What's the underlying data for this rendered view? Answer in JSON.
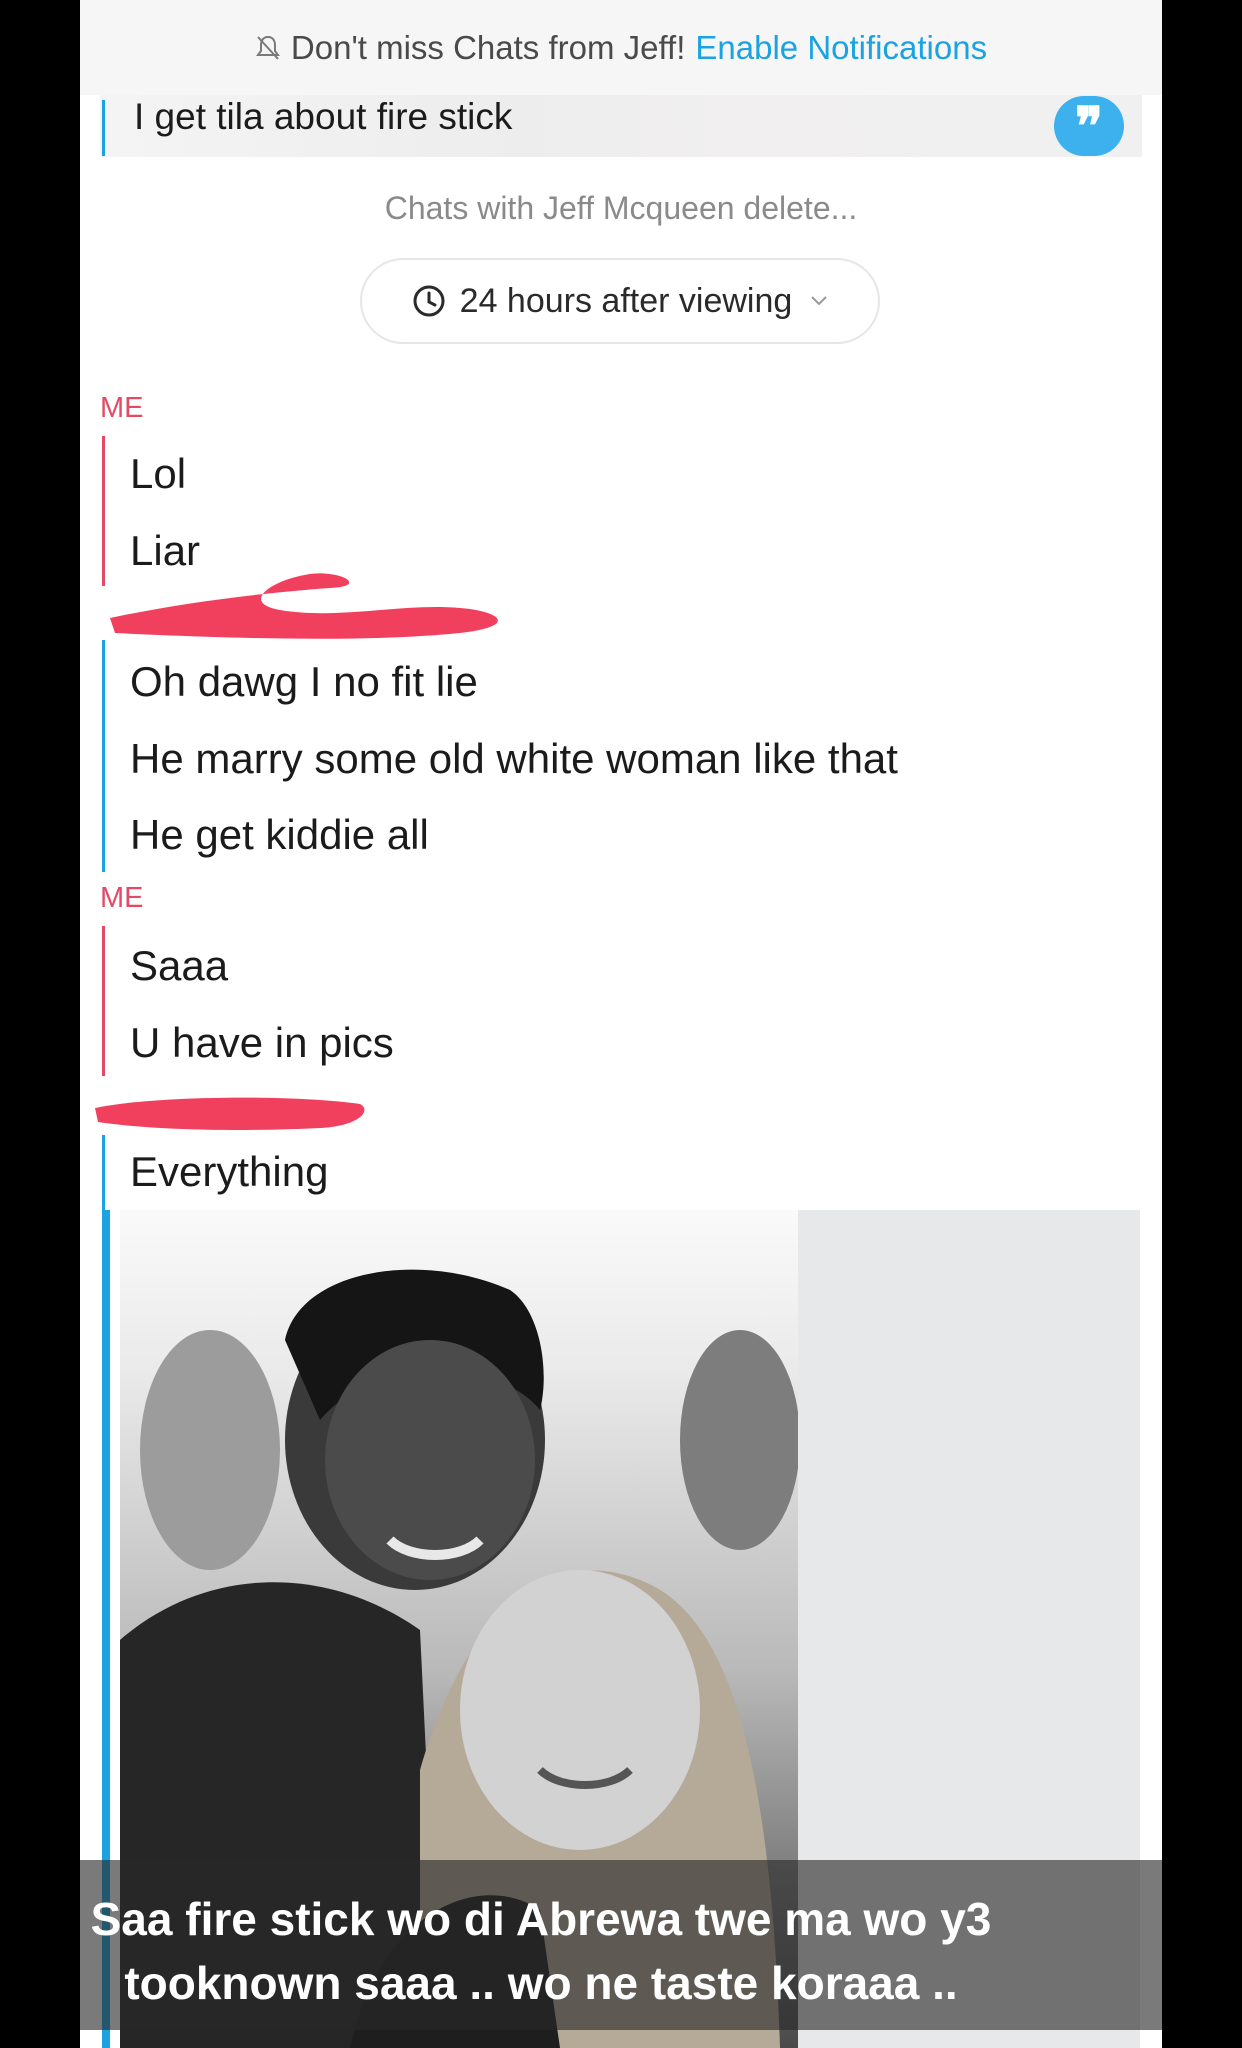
{
  "notification_bar": {
    "text": "Don't miss Chats from Jeff!",
    "link": "Enable Notifications"
  },
  "quoted_message": {
    "text": "I get tila about fire stick"
  },
  "chat_info": {
    "delete_text": "Chats with Jeff Mcqueen delete...",
    "timer_label": "24 hours after viewing"
  },
  "conversation": {
    "me_label_1": "ME",
    "me_msg_1": "Lol",
    "me_msg_2": "Liar",
    "them_msg_1": "Oh dawg I no fit lie",
    "them_msg_2": "He marry some old white woman like that",
    "them_msg_3": "He get kiddie all",
    "me_label_2": "ME",
    "me_msg_3": "Saaa",
    "me_msg_4": "U have in pics",
    "them_msg_4": "Everything"
  },
  "overlay_caption": {
    "line1": "Saa fire stick wo di Abrewa twe ma wo y3",
    "line2": "tooknown saaa .. wo ne taste koraaa .."
  },
  "colors": {
    "me_accent": "#e34a66",
    "them_accent": "#1aa3e0",
    "scribble": "#f0405e"
  }
}
